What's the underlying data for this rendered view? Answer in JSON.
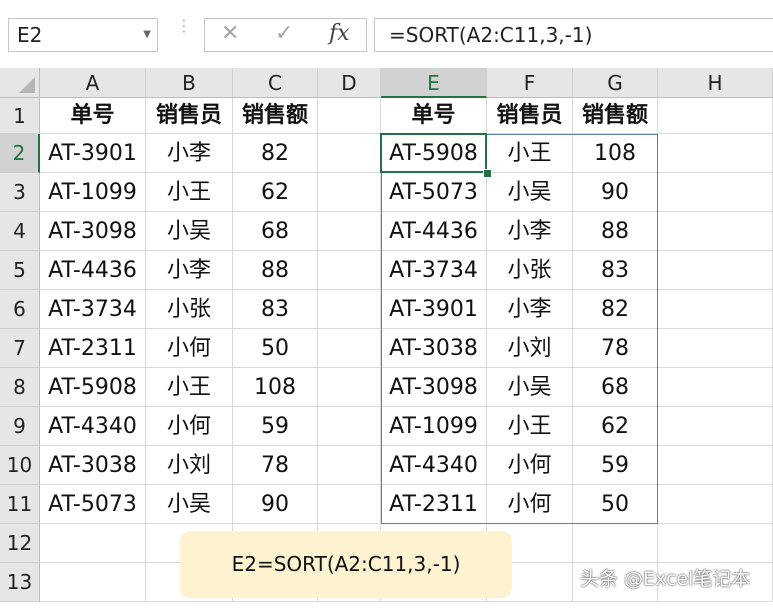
{
  "formula_bar": {
    "name_box": "E2",
    "formula": "=SORT(A2:C11,3,-1)",
    "cancel_symbol": "✕",
    "enter_symbol": "✓",
    "fx_symbol": "fx"
  },
  "columns": [
    "A",
    "B",
    "C",
    "D",
    "E",
    "F",
    "G",
    "H"
  ],
  "rows": [
    "1",
    "2",
    "3",
    "4",
    "5",
    "6",
    "7",
    "8",
    "9",
    "10",
    "11",
    "12",
    "13"
  ],
  "source_table": {
    "headers": [
      "单号",
      "销售员",
      "销售额"
    ],
    "rows": [
      [
        "AT-3901",
        "小李",
        "82"
      ],
      [
        "AT-1099",
        "小王",
        "62"
      ],
      [
        "AT-3098",
        "小吴",
        "68"
      ],
      [
        "AT-4436",
        "小李",
        "88"
      ],
      [
        "AT-3734",
        "小张",
        "83"
      ],
      [
        "AT-2311",
        "小何",
        "50"
      ],
      [
        "AT-5908",
        "小王",
        "108"
      ],
      [
        "AT-4340",
        "小何",
        "59"
      ],
      [
        "AT-3038",
        "小刘",
        "78"
      ],
      [
        "AT-5073",
        "小吴",
        "90"
      ]
    ]
  },
  "sorted_table": {
    "headers": [
      "单号",
      "销售员",
      "销售额"
    ],
    "rows": [
      [
        "AT-5908",
        "小王",
        "108"
      ],
      [
        "AT-5073",
        "小吴",
        "90"
      ],
      [
        "AT-4436",
        "小李",
        "88"
      ],
      [
        "AT-3734",
        "小张",
        "83"
      ],
      [
        "AT-3901",
        "小李",
        "82"
      ],
      [
        "AT-3038",
        "小刘",
        "78"
      ],
      [
        "AT-3098",
        "小吴",
        "68"
      ],
      [
        "AT-1099",
        "小王",
        "62"
      ],
      [
        "AT-4340",
        "小何",
        "59"
      ],
      [
        "AT-2311",
        "小何",
        "50"
      ]
    ]
  },
  "note": "E2=SORT(A2:C11,3,-1)",
  "watermark": "头条 @Excel笔记本",
  "colors": {
    "accent": "#217346",
    "spill_border": "#5b7fa6",
    "note_bg": "#fdf3d0"
  }
}
